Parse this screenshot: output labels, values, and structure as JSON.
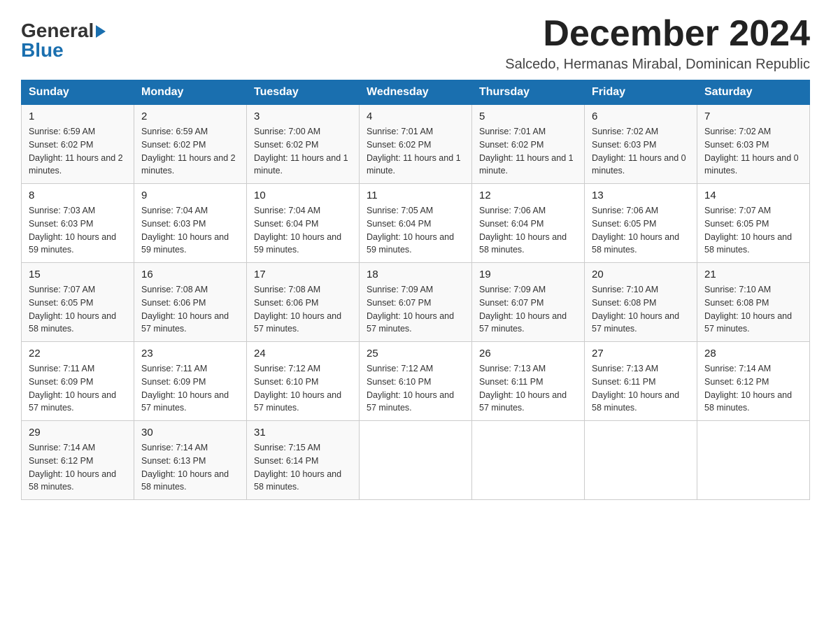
{
  "header": {
    "logo_general": "General",
    "logo_blue": "Blue",
    "month_title": "December 2024",
    "location": "Salcedo, Hermanas Mirabal, Dominican Republic"
  },
  "weekdays": [
    "Sunday",
    "Monday",
    "Tuesday",
    "Wednesday",
    "Thursday",
    "Friday",
    "Saturday"
  ],
  "weeks": [
    [
      {
        "day": "1",
        "sunrise": "Sunrise: 6:59 AM",
        "sunset": "Sunset: 6:02 PM",
        "daylight": "Daylight: 11 hours and 2 minutes."
      },
      {
        "day": "2",
        "sunrise": "Sunrise: 6:59 AM",
        "sunset": "Sunset: 6:02 PM",
        "daylight": "Daylight: 11 hours and 2 minutes."
      },
      {
        "day": "3",
        "sunrise": "Sunrise: 7:00 AM",
        "sunset": "Sunset: 6:02 PM",
        "daylight": "Daylight: 11 hours and 1 minute."
      },
      {
        "day": "4",
        "sunrise": "Sunrise: 7:01 AM",
        "sunset": "Sunset: 6:02 PM",
        "daylight": "Daylight: 11 hours and 1 minute."
      },
      {
        "day": "5",
        "sunrise": "Sunrise: 7:01 AM",
        "sunset": "Sunset: 6:02 PM",
        "daylight": "Daylight: 11 hours and 1 minute."
      },
      {
        "day": "6",
        "sunrise": "Sunrise: 7:02 AM",
        "sunset": "Sunset: 6:03 PM",
        "daylight": "Daylight: 11 hours and 0 minutes."
      },
      {
        "day": "7",
        "sunrise": "Sunrise: 7:02 AM",
        "sunset": "Sunset: 6:03 PM",
        "daylight": "Daylight: 11 hours and 0 minutes."
      }
    ],
    [
      {
        "day": "8",
        "sunrise": "Sunrise: 7:03 AM",
        "sunset": "Sunset: 6:03 PM",
        "daylight": "Daylight: 10 hours and 59 minutes."
      },
      {
        "day": "9",
        "sunrise": "Sunrise: 7:04 AM",
        "sunset": "Sunset: 6:03 PM",
        "daylight": "Daylight: 10 hours and 59 minutes."
      },
      {
        "day": "10",
        "sunrise": "Sunrise: 7:04 AM",
        "sunset": "Sunset: 6:04 PM",
        "daylight": "Daylight: 10 hours and 59 minutes."
      },
      {
        "day": "11",
        "sunrise": "Sunrise: 7:05 AM",
        "sunset": "Sunset: 6:04 PM",
        "daylight": "Daylight: 10 hours and 59 minutes."
      },
      {
        "day": "12",
        "sunrise": "Sunrise: 7:06 AM",
        "sunset": "Sunset: 6:04 PM",
        "daylight": "Daylight: 10 hours and 58 minutes."
      },
      {
        "day": "13",
        "sunrise": "Sunrise: 7:06 AM",
        "sunset": "Sunset: 6:05 PM",
        "daylight": "Daylight: 10 hours and 58 minutes."
      },
      {
        "day": "14",
        "sunrise": "Sunrise: 7:07 AM",
        "sunset": "Sunset: 6:05 PM",
        "daylight": "Daylight: 10 hours and 58 minutes."
      }
    ],
    [
      {
        "day": "15",
        "sunrise": "Sunrise: 7:07 AM",
        "sunset": "Sunset: 6:05 PM",
        "daylight": "Daylight: 10 hours and 58 minutes."
      },
      {
        "day": "16",
        "sunrise": "Sunrise: 7:08 AM",
        "sunset": "Sunset: 6:06 PM",
        "daylight": "Daylight: 10 hours and 57 minutes."
      },
      {
        "day": "17",
        "sunrise": "Sunrise: 7:08 AM",
        "sunset": "Sunset: 6:06 PM",
        "daylight": "Daylight: 10 hours and 57 minutes."
      },
      {
        "day": "18",
        "sunrise": "Sunrise: 7:09 AM",
        "sunset": "Sunset: 6:07 PM",
        "daylight": "Daylight: 10 hours and 57 minutes."
      },
      {
        "day": "19",
        "sunrise": "Sunrise: 7:09 AM",
        "sunset": "Sunset: 6:07 PM",
        "daylight": "Daylight: 10 hours and 57 minutes."
      },
      {
        "day": "20",
        "sunrise": "Sunrise: 7:10 AM",
        "sunset": "Sunset: 6:08 PM",
        "daylight": "Daylight: 10 hours and 57 minutes."
      },
      {
        "day": "21",
        "sunrise": "Sunrise: 7:10 AM",
        "sunset": "Sunset: 6:08 PM",
        "daylight": "Daylight: 10 hours and 57 minutes."
      }
    ],
    [
      {
        "day": "22",
        "sunrise": "Sunrise: 7:11 AM",
        "sunset": "Sunset: 6:09 PM",
        "daylight": "Daylight: 10 hours and 57 minutes."
      },
      {
        "day": "23",
        "sunrise": "Sunrise: 7:11 AM",
        "sunset": "Sunset: 6:09 PM",
        "daylight": "Daylight: 10 hours and 57 minutes."
      },
      {
        "day": "24",
        "sunrise": "Sunrise: 7:12 AM",
        "sunset": "Sunset: 6:10 PM",
        "daylight": "Daylight: 10 hours and 57 minutes."
      },
      {
        "day": "25",
        "sunrise": "Sunrise: 7:12 AM",
        "sunset": "Sunset: 6:10 PM",
        "daylight": "Daylight: 10 hours and 57 minutes."
      },
      {
        "day": "26",
        "sunrise": "Sunrise: 7:13 AM",
        "sunset": "Sunset: 6:11 PM",
        "daylight": "Daylight: 10 hours and 57 minutes."
      },
      {
        "day": "27",
        "sunrise": "Sunrise: 7:13 AM",
        "sunset": "Sunset: 6:11 PM",
        "daylight": "Daylight: 10 hours and 58 minutes."
      },
      {
        "day": "28",
        "sunrise": "Sunrise: 7:14 AM",
        "sunset": "Sunset: 6:12 PM",
        "daylight": "Daylight: 10 hours and 58 minutes."
      }
    ],
    [
      {
        "day": "29",
        "sunrise": "Sunrise: 7:14 AM",
        "sunset": "Sunset: 6:12 PM",
        "daylight": "Daylight: 10 hours and 58 minutes."
      },
      {
        "day": "30",
        "sunrise": "Sunrise: 7:14 AM",
        "sunset": "Sunset: 6:13 PM",
        "daylight": "Daylight: 10 hours and 58 minutes."
      },
      {
        "day": "31",
        "sunrise": "Sunrise: 7:15 AM",
        "sunset": "Sunset: 6:14 PM",
        "daylight": "Daylight: 10 hours and 58 minutes."
      },
      null,
      null,
      null,
      null
    ]
  ]
}
